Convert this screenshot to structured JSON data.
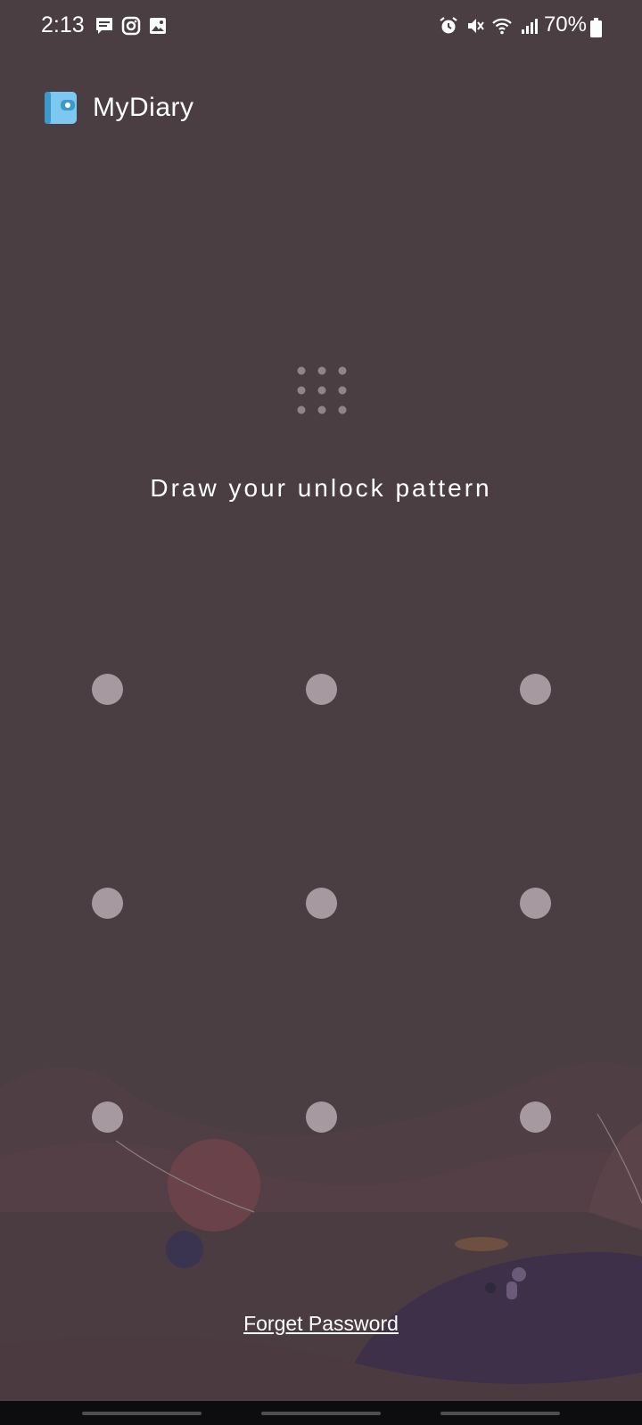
{
  "status_bar": {
    "time": "2:13",
    "battery": "70%",
    "left_icons": [
      "message-icon",
      "instagram-icon",
      "gallery-icon"
    ],
    "right_icons": [
      "alarm-icon",
      "mute-icon",
      "wifi-icon",
      "signal-icon",
      "battery-icon"
    ]
  },
  "app": {
    "name": "MyDiary",
    "logo": "mydiary-logo-icon"
  },
  "lock_screen": {
    "keypad_icon": "keypad-icon",
    "prompt": "Draw your unlock pattern",
    "pattern_dots": 9,
    "forget_password": "Forget Password"
  },
  "colors": {
    "background": "#4a3e43",
    "dot": "#a69aa0",
    "logo_accent": "#5bb6e8"
  }
}
